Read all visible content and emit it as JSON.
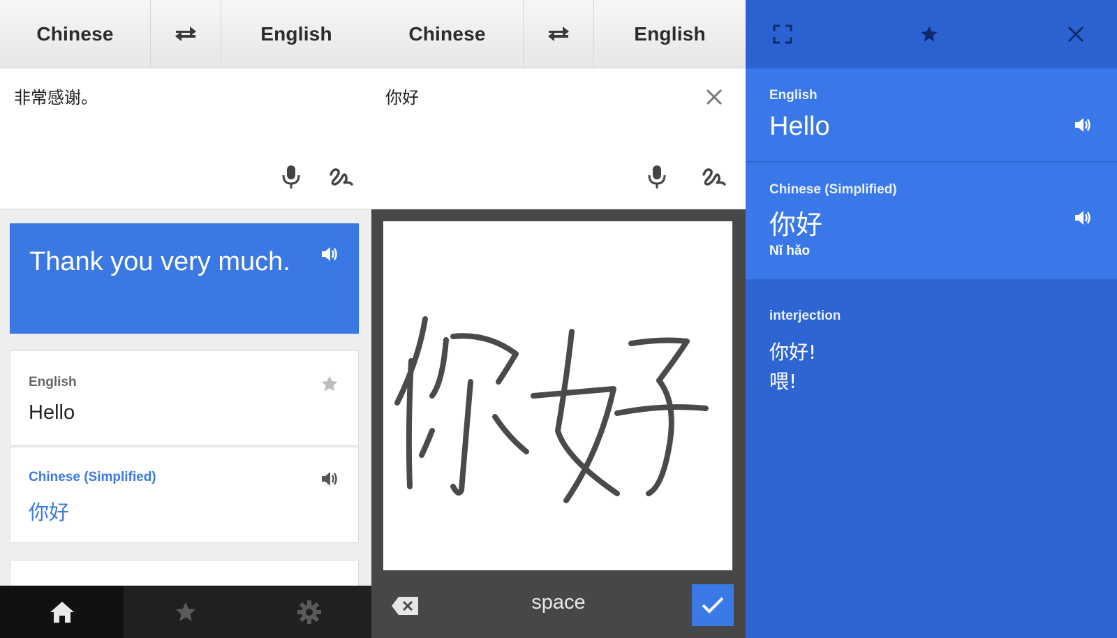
{
  "panel1": {
    "source_lang": "Chinese",
    "target_lang": "English",
    "input_text": "非常感谢。",
    "result_text": "Thank you very much.",
    "cards": [
      {
        "label": "English",
        "value": "Hello"
      },
      {
        "label": "Chinese (Simplified)",
        "value": "你好"
      }
    ],
    "nav": [
      "home-icon",
      "star-icon",
      "gear-icon"
    ]
  },
  "panel2": {
    "source_lang": "Chinese",
    "target_lang": "English",
    "input_text": "你好",
    "handwriting_space_label": "space"
  },
  "panel3": {
    "sections": [
      {
        "label": "English",
        "value": "Hello"
      },
      {
        "label": "Chinese (Simplified)",
        "value": "你好",
        "romanization": "Nǐ hǎo"
      }
    ],
    "part_of_speech": "interjection",
    "dictionary_entries": [
      "你好!",
      "喂!"
    ]
  },
  "colors": {
    "accent_blue": "#3a78e4",
    "panel3_blue": "#2f65d3",
    "chinese_label_blue": "#3a78e4"
  }
}
